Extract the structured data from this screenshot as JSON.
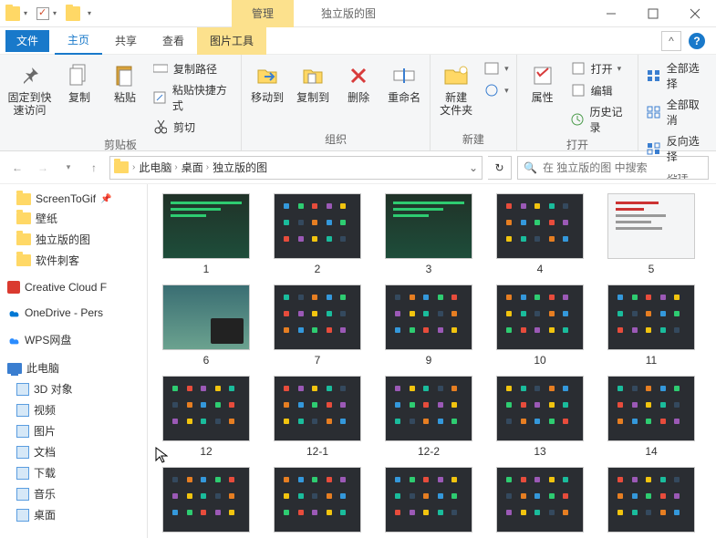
{
  "window": {
    "title": "独立版的图",
    "context_tab": "管理"
  },
  "tabs": {
    "file": "文件",
    "home": "主页",
    "share": "共享",
    "view": "查看",
    "picture_tools": "图片工具"
  },
  "ribbon": {
    "pin": "固定到快\n速访问",
    "copy": "复制",
    "paste": "粘贴",
    "copy_path": "复制路径",
    "paste_shortcut": "粘贴快捷方式",
    "cut": "剪切",
    "group_clipboard": "剪贴板",
    "move_to": "移动到",
    "copy_to": "复制到",
    "delete": "删除",
    "rename": "重命名",
    "group_organize": "组织",
    "new_folder": "新建\n文件夹",
    "group_new": "新建",
    "properties": "属性",
    "open": "打开",
    "edit": "编辑",
    "history": "历史记录",
    "group_open": "打开",
    "select_all": "全部选择",
    "select_none": "全部取消",
    "invert": "反向选择",
    "group_select": "选择"
  },
  "breadcrumbs": [
    "此电脑",
    "桌面",
    "独立版的图"
  ],
  "search": {
    "placeholder": "在 独立版的图 中搜索"
  },
  "sidebar": [
    {
      "label": "ScreenToGif",
      "icon": "folder",
      "pinned": true,
      "indent": 1
    },
    {
      "label": "壁纸",
      "icon": "folder",
      "pinned": false,
      "indent": 1
    },
    {
      "label": "独立版的图",
      "icon": "folder",
      "pinned": false,
      "indent": 1
    },
    {
      "label": "软件刺客",
      "icon": "folder",
      "pinned": false,
      "indent": 1
    },
    {
      "label": "Creative Cloud F",
      "icon": "cc",
      "indent": 0
    },
    {
      "label": "OneDrive - Pers",
      "icon": "onedrive",
      "indent": 0
    },
    {
      "label": "WPS网盘",
      "icon": "wps",
      "indent": 0
    },
    {
      "label": "此电脑",
      "icon": "pc",
      "indent": 0
    },
    {
      "label": "3D 对象",
      "icon": "lib",
      "indent": 1
    },
    {
      "label": "视频",
      "icon": "lib",
      "indent": 1
    },
    {
      "label": "图片",
      "icon": "lib",
      "indent": 1
    },
    {
      "label": "文档",
      "icon": "lib",
      "indent": 1
    },
    {
      "label": "下载",
      "icon": "lib",
      "indent": 1
    },
    {
      "label": "音乐",
      "icon": "lib",
      "indent": 1
    },
    {
      "label": "桌面",
      "icon": "lib",
      "indent": 1
    }
  ],
  "thumbs": [
    {
      "name": "1",
      "variant": "green"
    },
    {
      "name": "2",
      "variant": "dark"
    },
    {
      "name": "3",
      "variant": "green"
    },
    {
      "name": "4",
      "variant": "dark"
    },
    {
      "name": "5",
      "variant": "light"
    },
    {
      "name": "6",
      "variant": "pic"
    },
    {
      "name": "7",
      "variant": "dark"
    },
    {
      "name": "9",
      "variant": "dark"
    },
    {
      "name": "10",
      "variant": "dark"
    },
    {
      "name": "11",
      "variant": "dark"
    },
    {
      "name": "12",
      "variant": "dark"
    },
    {
      "name": "12-1",
      "variant": "dark"
    },
    {
      "name": "12-2",
      "variant": "dark"
    },
    {
      "name": "13",
      "variant": "dark"
    },
    {
      "name": "14",
      "variant": "dark"
    },
    {
      "name": "",
      "variant": "dark"
    },
    {
      "name": "",
      "variant": "dark"
    },
    {
      "name": "",
      "variant": "dark"
    },
    {
      "name": "",
      "variant": "dark"
    },
    {
      "name": "",
      "variant": "dark"
    }
  ]
}
